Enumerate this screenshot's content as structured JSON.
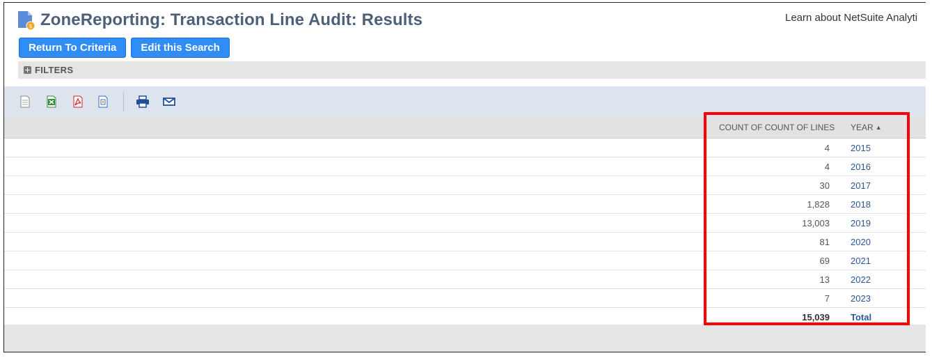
{
  "header": {
    "title": "ZoneReporting: Transaction Line Audit: Results",
    "learn_link": "Learn about NetSuite Analyti"
  },
  "buttons": {
    "return_label": "Return To Criteria",
    "edit_label": "Edit this Search"
  },
  "filters": {
    "label": "FILTERS",
    "icon": "plus-icon"
  },
  "toolbar": {
    "icons": [
      "export-csv-icon",
      "export-excel-icon",
      "export-pdf-icon",
      "export-word-icon",
      "print-icon",
      "email-icon"
    ]
  },
  "table": {
    "columns": {
      "count": "COUNT OF COUNT OF LINES",
      "year": "YEAR",
      "year_sort": "▲"
    },
    "rows": [
      {
        "count": "4",
        "year": "2015"
      },
      {
        "count": "4",
        "year": "2016"
      },
      {
        "count": "30",
        "year": "2017"
      },
      {
        "count": "1,828",
        "year": "2018"
      },
      {
        "count": "13,003",
        "year": "2019"
      },
      {
        "count": "81",
        "year": "2020"
      },
      {
        "count": "69",
        "year": "2021"
      },
      {
        "count": "13",
        "year": "2022"
      },
      {
        "count": "7",
        "year": "2023"
      }
    ],
    "total": {
      "count": "15,039",
      "label": "Total"
    }
  },
  "colors": {
    "primary_button": "#2f8df5",
    "title": "#4d5f79",
    "link": "#2b5797",
    "highlight": "#ff0000",
    "toolbar_bg": "#dde4ee"
  }
}
